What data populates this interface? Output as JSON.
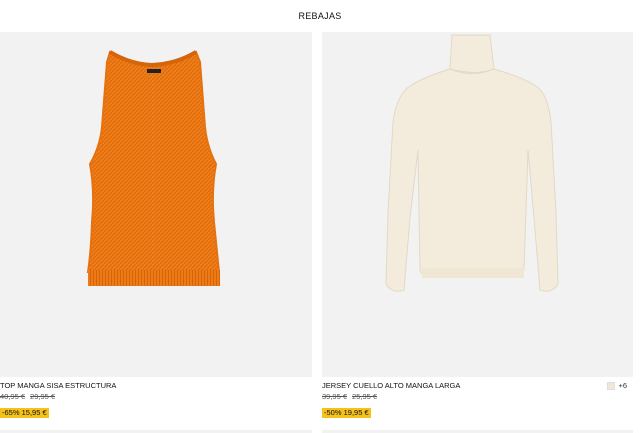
{
  "header": {
    "title": "REBAJAS"
  },
  "products": [
    {
      "name": "TOP MANGA SISA ESTRUCTURA",
      "old_price_1": "40,95 €",
      "old_price_2": "29,95 €",
      "discount": "-65%",
      "sale_price": "15,95 €",
      "garment_color": "#f07d17",
      "image_icon": "knit-tank-top"
    },
    {
      "name": "JERSEY CUELLO ALTO MANGA LARGA",
      "old_price_1": "39,95 €",
      "old_price_2": "25,95 €",
      "discount": "-50%",
      "sale_price": "19,95 €",
      "more_colors": "+6",
      "garment_color": "#f3ecdc",
      "image_icon": "turtleneck-sweater"
    }
  ],
  "colors": {
    "badge": "#f5c21b",
    "image_bg": "#f2f2f2"
  }
}
